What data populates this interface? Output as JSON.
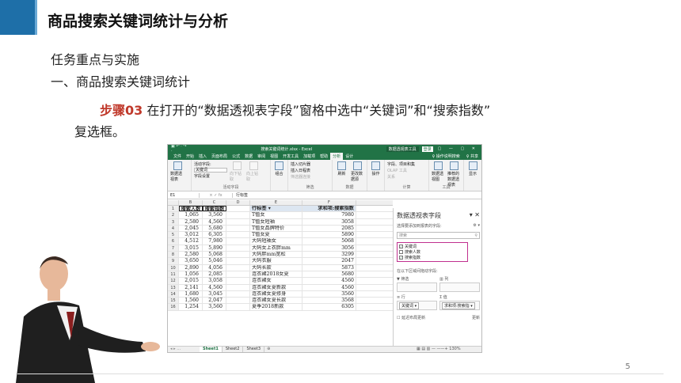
{
  "slide": {
    "title": "商品搜索关键词统计与分析",
    "subtitle": "任务重点与实施",
    "section": "一、商品搜索关键词统计",
    "step_label": "步骤03",
    "step_text": "在打开的“数据透视表字段”窗格中选中“关键词”和“搜索指数”",
    "step_text_cont": "复选框。",
    "page_number": "5"
  },
  "excel": {
    "quick_access": "▣ ↶ · ↷ ·",
    "doc_title": "搜索关键词统计.xlsx - Excel",
    "context_tab": "数据透视表工具",
    "login": "登录",
    "window_controls": "▢ — ▢ ✕",
    "tabs": [
      "文件",
      "开始",
      "插入",
      "页面布局",
      "公式",
      "数据",
      "审阅",
      "视图",
      "开发工具",
      "加载项",
      "帮助",
      "分析",
      "设计"
    ],
    "active_tab": "分析",
    "tell_me": "♀ 操作说明搜索",
    "share": "♀ 共享",
    "ribbon": {
      "pivot_btn": "数据透视表",
      "active_field_label": "活动字段:",
      "active_field_value": "关键词",
      "field_settings": "字段设置",
      "drill_down": "向下钻取",
      "drill_up": "向上钻取",
      "group_active": "活动字段",
      "group_btn": "组合",
      "insert_slicer": "插入切片器",
      "insert_timeline": "插入日程表",
      "filter_conn": "筛选器连接",
      "group_filter": "筛选",
      "refresh": "刷新",
      "change_source": "更改数据源",
      "group_data": "数据",
      "actions": "操作",
      "fields_items": "字段、项目和集",
      "olap": "OLAP 工具",
      "relationships": "关系",
      "group_calc": "计算",
      "pivot_chart": "数据透视图",
      "recommended": "推荐的数据透视表",
      "group_tools": "工具",
      "show": "显示"
    },
    "name_box": "E1",
    "fx": "× ✓ fx",
    "formula": "行标签",
    "columns": [
      "B",
      "C",
      "D",
      "E",
      "F"
    ],
    "row_numbers": [
      "1",
      "2",
      "3",
      "4",
      "5",
      "6",
      "7",
      "8",
      "9",
      "10",
      "11",
      "12",
      "13",
      "14",
      "15",
      "16"
    ],
    "col_b": [
      "搜索人数",
      "1,065",
      "2,580",
      "2,045",
      "3,012",
      "4,512",
      "3,015",
      "2,580",
      "3,650",
      "2,890",
      "1,056",
      "2,015",
      "2,141",
      "1,680",
      "1,560",
      "1,254"
    ],
    "col_c": [
      "搜索指数",
      "3,560",
      "4,560",
      "5,680",
      "6,305",
      "7,980",
      "5,890",
      "5,068",
      "5,046",
      "4,056",
      "2,085",
      "3,058",
      "4,560",
      "3,045",
      "2,047",
      "3,560"
    ],
    "col_e": [
      "行标签 ▾",
      "T恤女",
      "T恤女短袖",
      "T恤女品牌特价",
      "T恤女夏",
      "大码短袖女",
      "大码女上衣胖mm",
      "大码胖mm宽松",
      "大码衣服",
      "大码长款",
      "连衣裙2018女夏",
      "连衣裙女",
      "连衣裙女夏新款",
      "连衣裙女夏修身",
      "连衣裙女夏长款",
      "夏季2018新款"
    ],
    "col_f": [
      "求和项:搜索指数",
      "7980",
      "3058",
      "2085",
      "5890",
      "5068",
      "3056",
      "3299",
      "2047",
      "5873",
      "5680",
      "4560",
      "4560",
      "3560",
      "3568",
      "6305"
    ],
    "sheet_nav": "◂ ▸ …",
    "sheets": [
      "Sheet1",
      "Sheet2",
      "Sheet3"
    ],
    "active_sheet": "Sheet1",
    "status_right": "▦ ▤ ▥ — ——+ 130%",
    "pane": {
      "title": "数据透视表字段",
      "close": "▾ ✕",
      "hint": "选择要添加到报表的字段:",
      "gear": "⚙ ▾",
      "search_placeholder": "搜索",
      "search_icon": "⚲",
      "fields": [
        {
          "label": "关键词",
          "checked": "✓"
        },
        {
          "label": "搜索人数",
          "checked": ""
        },
        {
          "label": "搜索指数",
          "checked": "✓"
        }
      ],
      "drag_hint": "在以下区域间拖动字段:",
      "filter_area": "▼ 筛选",
      "column_area": "▥ 列",
      "row_area": "≡ 行",
      "value_area": "Σ 值",
      "row_pill": "关键词 ▾",
      "value_pill": "求和项:搜索指 ▾",
      "defer": "☐ 延迟布局更新",
      "update": "更新"
    }
  },
  "colors": {
    "accent": "#1e6fa8",
    "excel_green": "#217346",
    "step_red": "#c0392b",
    "highlight": "#c0308f"
  }
}
